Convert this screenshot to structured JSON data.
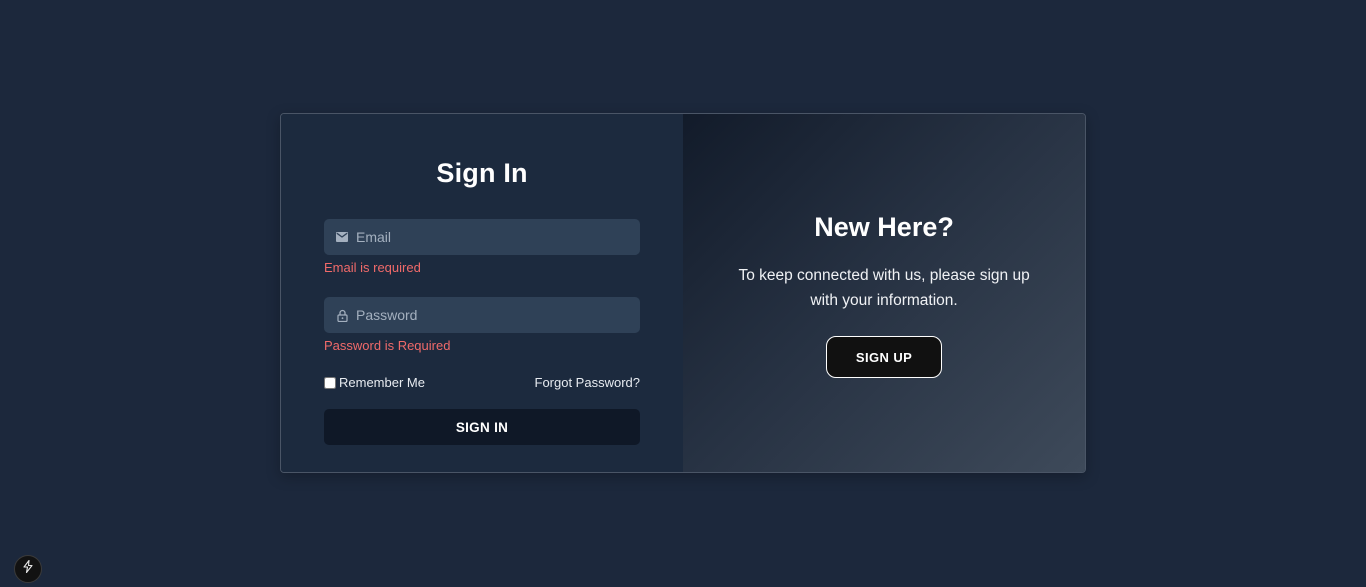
{
  "signin": {
    "title": "Sign In",
    "email": {
      "placeholder": "Email",
      "value": "",
      "icon": "mail-icon",
      "error": "Email is required"
    },
    "password": {
      "placeholder": "Password",
      "value": "",
      "icon": "lock-icon",
      "error": "Password is Required"
    },
    "remember_label": "Remember Me",
    "remember_checked": false,
    "forgot_label": "Forgot Password?",
    "button_label": "SIGN IN"
  },
  "signup_panel": {
    "title": "New Here?",
    "message": "To keep connected with us, please sign up with your information.",
    "button_label": "SIGN UP"
  },
  "corner_badge": {
    "icon": "lightning-icon"
  },
  "colors": {
    "page_bg": "#1c283c",
    "panel_bg": "#1c2a3e",
    "input_bg": "#2f4157",
    "error": "#f06a6a",
    "button_dark": "#0f1827"
  }
}
